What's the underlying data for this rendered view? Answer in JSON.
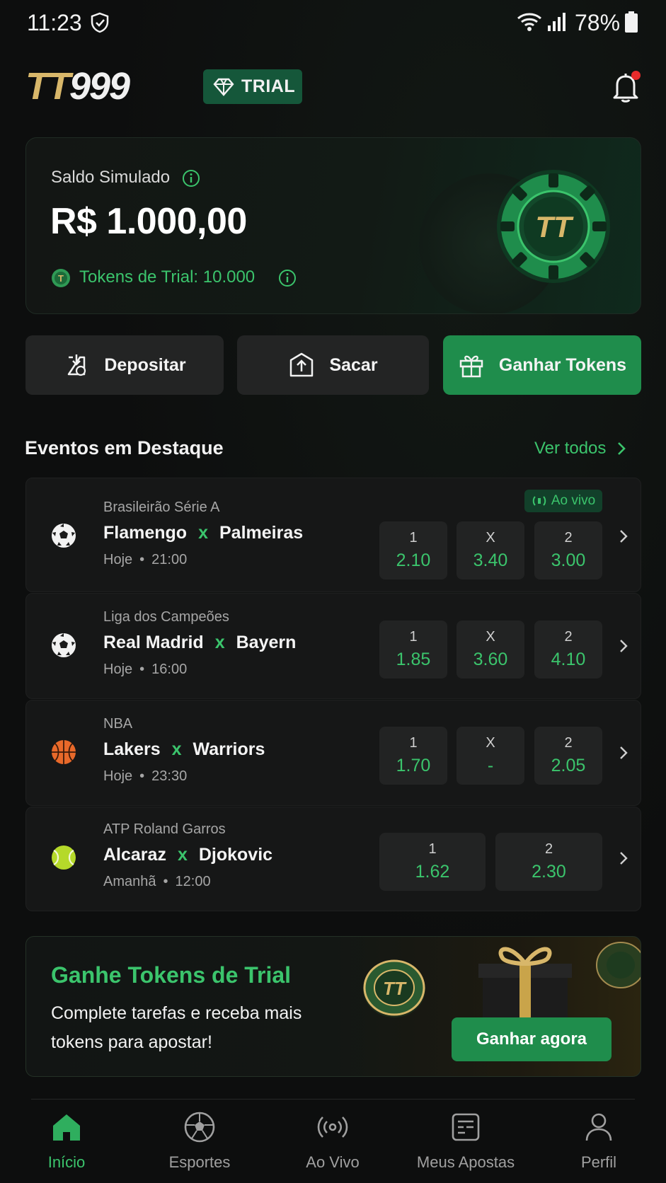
{
  "status_bar": {
    "time": "11:23",
    "battery": "78%"
  },
  "header": {
    "logo_part1": "TT",
    "logo_part2": "999",
    "trial_label": "TRIAL"
  },
  "balance": {
    "label": "Saldo Simulado",
    "value": "R$ 1.000,00",
    "tokens_label": "Tokens de Trial: 10.000",
    "chip_text": "TT"
  },
  "actions": {
    "deposit": "Depositar",
    "withdraw": "Sacar",
    "earn": "Ganhar Tokens"
  },
  "featured": {
    "title": "Eventos em Destaque",
    "see_all": "Ver todos"
  },
  "events": [
    {
      "league": "Brasileirão Série A",
      "home": "Flamengo",
      "vs": "x",
      "away": "Palmeiras",
      "day": "Hoje",
      "time": "21:00",
      "sport_icon": "soccer-ball-icon",
      "live": "Ao vivo",
      "odds": [
        {
          "label": "1",
          "value": "2.10"
        },
        {
          "label": "X",
          "value": "3.40"
        },
        {
          "label": "2",
          "value": "3.00"
        }
      ]
    },
    {
      "league": "Liga dos Campeões",
      "home": "Real Madrid",
      "vs": "x",
      "away": "Bayern",
      "day": "Hoje",
      "time": "16:00",
      "sport_icon": "soccer-ball-icon",
      "odds": [
        {
          "label": "1",
          "value": "1.85"
        },
        {
          "label": "X",
          "value": "3.60"
        },
        {
          "label": "2",
          "value": "4.10"
        }
      ]
    },
    {
      "league": "NBA",
      "home": "Lakers",
      "vs": "x",
      "away": "Warriors",
      "day": "Hoje",
      "time": "23:30",
      "sport_icon": "basketball-icon",
      "odds": [
        {
          "label": "1",
          "value": "1.70"
        },
        {
          "label": "X",
          "value": "-"
        },
        {
          "label": "2",
          "value": "2.05"
        }
      ]
    },
    {
      "league": "ATP Roland Garros",
      "home": "Alcaraz",
      "vs": "x",
      "away": "Djokovic",
      "day": "Amanhã",
      "time": "12:00",
      "sport_icon": "tennis-ball-icon",
      "odds": [
        {
          "label": "1",
          "value": "1.62"
        },
        {
          "label": "2",
          "value": "2.30"
        }
      ]
    }
  ],
  "promo": {
    "title": "Ganhe Tokens de Trial",
    "text": "Complete tarefas e receba mais tokens para apostar!",
    "button": "Ganhar agora",
    "coin_text": "TT"
  },
  "bottom_nav": [
    {
      "label": "Início",
      "icon": "home-icon",
      "active": true
    },
    {
      "label": "Esportes",
      "icon": "soccer-ball-icon",
      "active": false
    },
    {
      "label": "Ao Vivo",
      "icon": "broadcast-icon",
      "active": false
    },
    {
      "label": "Meus Apostas",
      "icon": "ticket-icon",
      "active": false
    },
    {
      "label": "Perfil",
      "icon": "user-icon",
      "active": false
    }
  ],
  "colors": {
    "accent": "#3bc46c",
    "button_green": "#1f8d4c",
    "background": "#0d0e0e",
    "card": "#161717",
    "gold": "#d8b76a"
  }
}
